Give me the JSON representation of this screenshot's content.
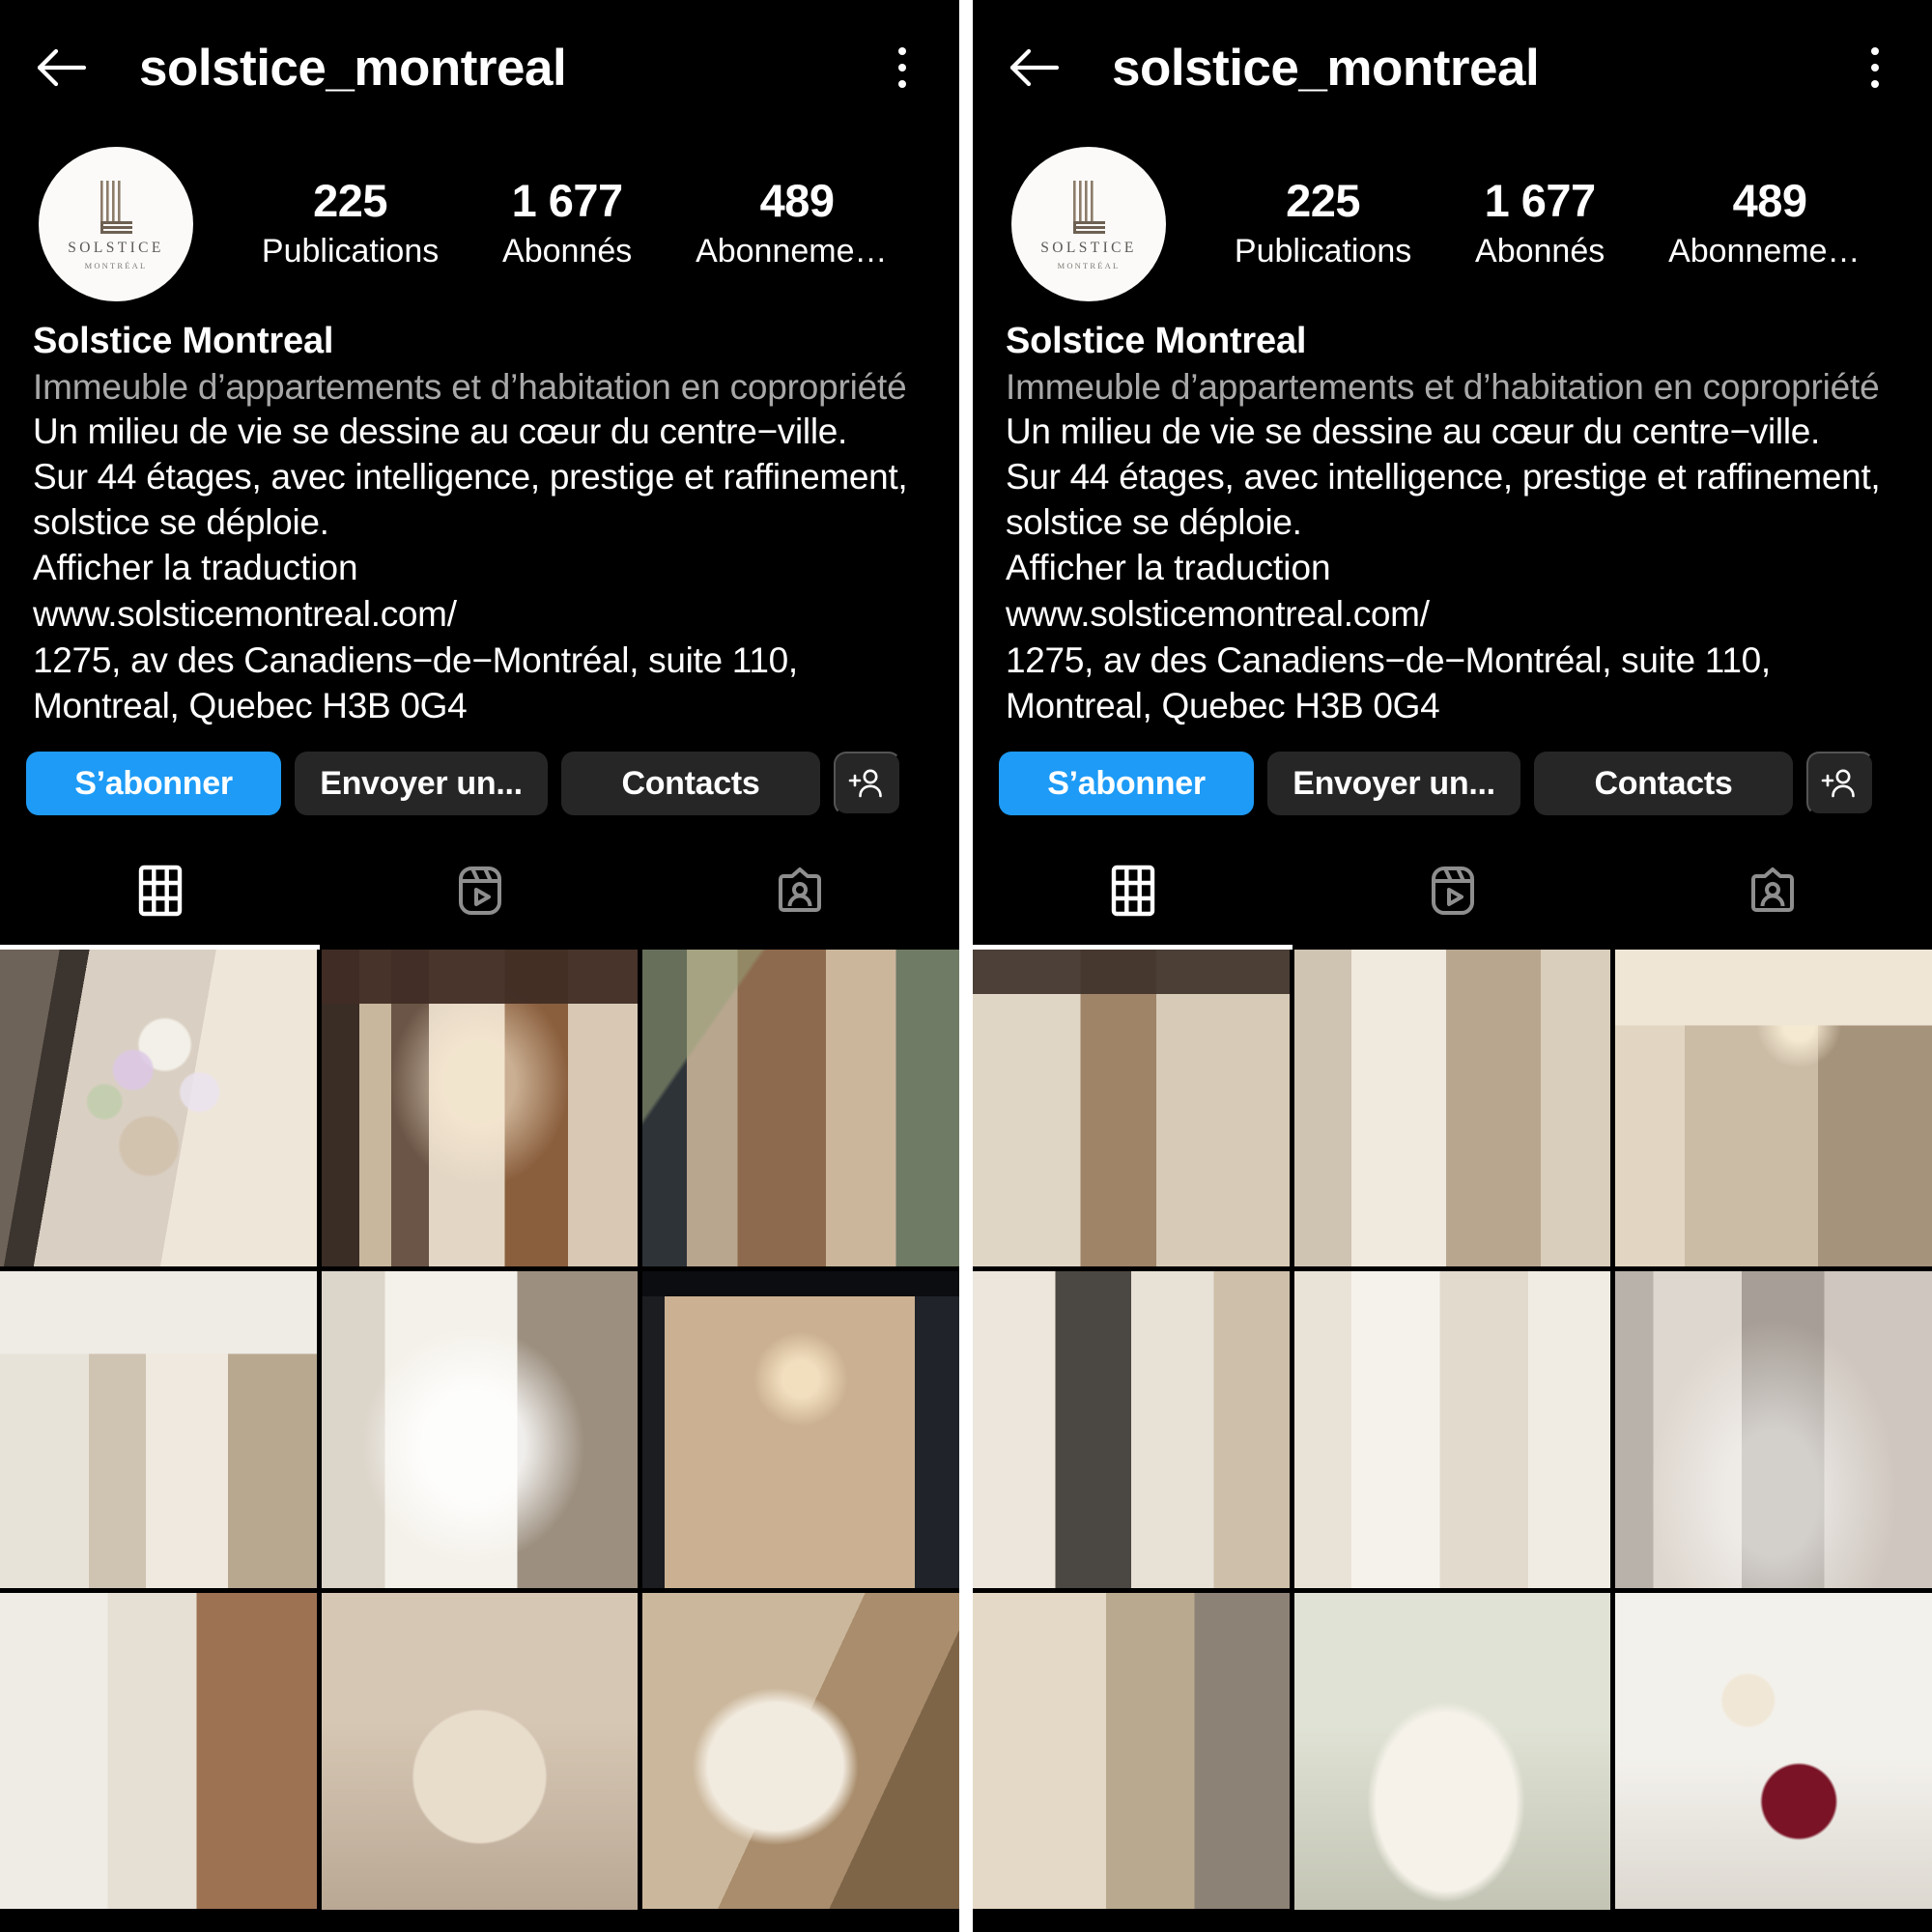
{
  "app": {
    "theme_background": "#000000",
    "accent_blue": "#1d9bf6",
    "muted_text": "#a8a8a8"
  },
  "header": {
    "back_icon": "back-arrow-icon",
    "username": "solstice_montreal",
    "menu_icon": "kebab-menu-icon"
  },
  "profile": {
    "avatar": {
      "brand": "SOLSTICE",
      "brand_sub": "MONTRÉAL",
      "icon": "solstice-logo-mark"
    },
    "stats": [
      {
        "value": "225",
        "label": "Publications"
      },
      {
        "value": "1 677",
        "label": "Abonnés"
      },
      {
        "value": "489",
        "label": "Abonnemen..."
      }
    ]
  },
  "bio": {
    "name": "Solstice Montreal",
    "category": "Immeuble d’appartements et d’habitation en copropriété",
    "lines": [
      "Un milieu de vie se dessine au cœur du centre−ville.",
      "Sur 44 étages, avec intelligence, prestige et raffinement,",
      "solstice se déploie."
    ],
    "translate_label": "Afficher la traduction",
    "website": "www.solsticemontreal.com/",
    "address": "1275, av des Canadiens−de−Montréal, suite 110, Montreal, Quebec H3B 0G4"
  },
  "actions": {
    "follow_label": "S’abonner",
    "message_label": "Envoyer un...",
    "contact_label": "Contacts",
    "add_person_icon": "add-person-icon"
  },
  "tabs": [
    {
      "id": "grid",
      "icon": "grid-icon",
      "active": true
    },
    {
      "id": "reels",
      "icon": "reels-icon",
      "active": false
    },
    {
      "id": "tagged",
      "icon": "tagged-person-icon",
      "active": false
    }
  ],
  "panels": [
    {
      "id": "panel-left",
      "grid": [
        {
          "name": "post-flower-vase-living-room",
          "style": "ph-flowers"
        },
        {
          "name": "post-lobby-lounge-interior",
          "style": "ph-lobby"
        },
        {
          "name": "post-tower-street-exterior",
          "style": "ph-tower"
        },
        {
          "name": "post-kitchen-island",
          "style": "ph-kitchen"
        },
        {
          "name": "post-bedroom-white-sofa",
          "style": "ph-bedroom"
        },
        {
          "name": "post-tablet-lobby-render",
          "style": "ph-tablet"
        },
        {
          "name": "post-wine-cellar",
          "style": "ph-wine"
        },
        {
          "name": "post-pizza-plating",
          "style": "ph-pizza"
        },
        {
          "name": "post-sculpture-detail",
          "style": "ph-sculpture"
        }
      ]
    },
    {
      "id": "panel-right",
      "grid": [
        {
          "name": "post-bar-counter-stools",
          "style": "ph-bar"
        },
        {
          "name": "post-building-exterior-night",
          "style": "ph-exterior"
        },
        {
          "name": "post-private-dining-room",
          "style": "ph-diningroom"
        },
        {
          "name": "post-kitchen-dark-cabinets",
          "style": "ph-kitchen2"
        },
        {
          "name": "post-walk-in-closet",
          "style": "ph-closet"
        },
        {
          "name": "post-winter-forest",
          "style": "ph-forest"
        },
        {
          "name": "post-solstice-signage-wall",
          "style": "ph-signage"
        },
        {
          "name": "post-dessert-plate-strawberry",
          "style": "ph-dessert1"
        },
        {
          "name": "post-dessert-red-glaze",
          "style": "ph-dessert2"
        }
      ]
    }
  ]
}
